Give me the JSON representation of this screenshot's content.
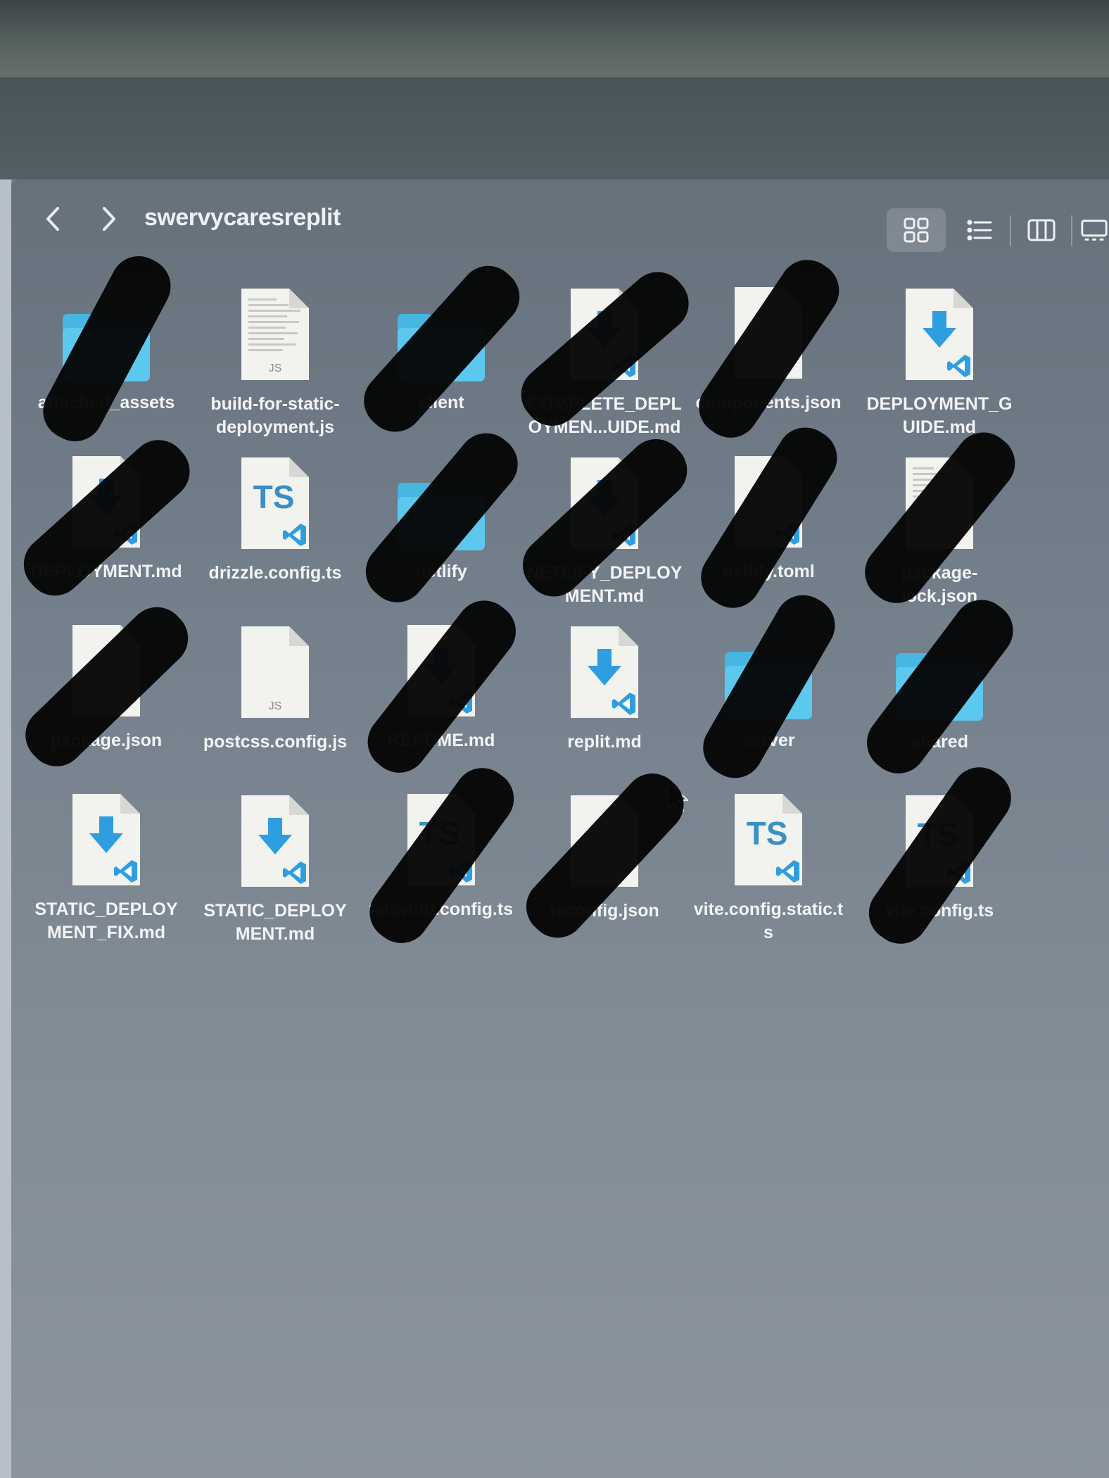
{
  "window": {
    "title": "swervycaresreplit"
  },
  "toolbar": {
    "back_icon": "chevron-left-icon",
    "forward_icon": "chevron-right-icon",
    "views": [
      "icon-grid-view-icon",
      "list-view-icon",
      "column-view-icon",
      "gallery-view-icon"
    ],
    "active_view": "icon-grid-view-icon"
  },
  "colors": {
    "folder": "#5cc8ee",
    "vscode_accent": "#2f9ee0",
    "ts_text": "#3a8fc4"
  },
  "files": [
    {
      "name": "attached_assets",
      "kind": "folder",
      "redacted": true
    },
    {
      "name": "build-for-static-\ndeployment.js",
      "kind": "js-doc",
      "redacted": false
    },
    {
      "name": "client",
      "kind": "folder",
      "redacted": true
    },
    {
      "name": "COMPLETE_DEPL\nOYMEN...UIDE.md",
      "kind": "md",
      "redacted": true
    },
    {
      "name": "components.json",
      "kind": "blank",
      "redacted": true
    },
    {
      "name": "DEPLOYMENT_G\nUIDE.md",
      "kind": "md",
      "redacted": false
    },
    {
      "name": "DEPLOYMENT.md",
      "kind": "md",
      "redacted": true
    },
    {
      "name": "drizzle.config.ts",
      "kind": "ts",
      "redacted": false
    },
    {
      "name": "netlify",
      "kind": "folder",
      "redacted": true
    },
    {
      "name": "NETLIFY_DEPLOY\nMENT.md",
      "kind": "md",
      "redacted": true
    },
    {
      "name": "netlify.toml",
      "kind": "vs",
      "redacted": true
    },
    {
      "name": "package-\nlock.json",
      "kind": "doc",
      "redacted": true
    },
    {
      "name": "package.json",
      "kind": "blank",
      "redacted": true
    },
    {
      "name": "postcss.config.js",
      "kind": "js",
      "redacted": false
    },
    {
      "name": "README.md",
      "kind": "md",
      "redacted": true
    },
    {
      "name": "replit.md",
      "kind": "md",
      "redacted": false
    },
    {
      "name": "server",
      "kind": "folder",
      "redacted": true
    },
    {
      "name": "shared",
      "kind": "folder",
      "redacted": true
    },
    {
      "name": "STATIC_DEPLOY\nMENT_FIX.md",
      "kind": "md",
      "redacted": false
    },
    {
      "name": "STATIC_DEPLOY\nMENT.md",
      "kind": "md",
      "redacted": false
    },
    {
      "name": "tailwind.config.ts",
      "kind": "ts",
      "redacted": true
    },
    {
      "name": "tsconfig.json",
      "kind": "blank",
      "redacted": true
    },
    {
      "name": "vite.config.static.t\ns",
      "kind": "ts",
      "redacted": false
    },
    {
      "name": "vite.config.ts",
      "kind": "ts",
      "redacted": true
    }
  ]
}
